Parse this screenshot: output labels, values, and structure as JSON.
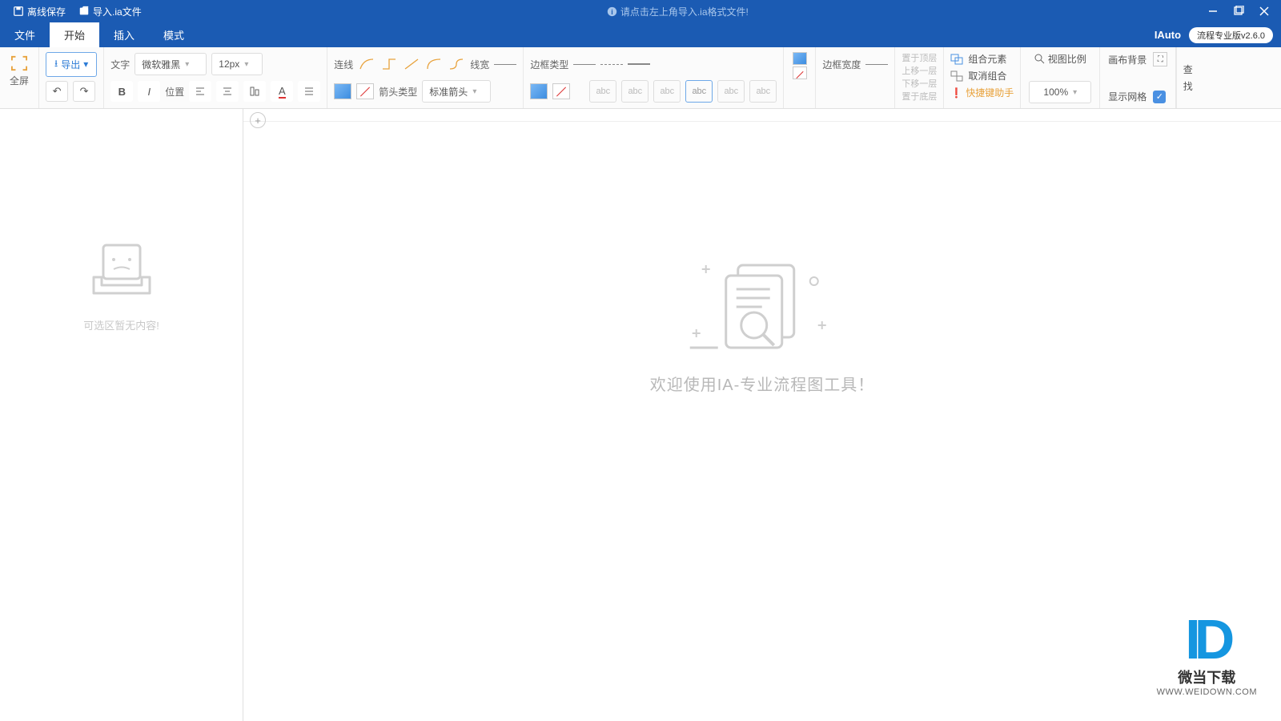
{
  "titlebar": {
    "offline_save": "离线保存",
    "import_ia": "导入.ia文件",
    "hint": "请点击左上角导入.ia格式文件!"
  },
  "menubar": {
    "items": [
      "文件",
      "开始",
      "插入",
      "模式"
    ],
    "active_index": 1,
    "brand": "IAuto",
    "version": "流程专业版v2.6.0"
  },
  "ribbon": {
    "fullscreen": "全屏",
    "export": "导出",
    "text": "文字",
    "font_family": "微软雅黑",
    "font_size": "12px",
    "position": "位置",
    "line": "连线",
    "line_width": "线宽",
    "arrow_type": "箭头类型",
    "arrow_style": "标准箭头",
    "border_type": "边框类型",
    "border_width": "边框宽度",
    "abc": "abc",
    "layer": {
      "top": "置于顶层",
      "up": "上移一层",
      "down": "下移一层",
      "bottom": "置于底层"
    },
    "group": "组合元素",
    "ungroup": "取消组合",
    "hotkey": "快捷键助手",
    "zoom_label": "视图比例",
    "zoom_value": "100%",
    "canvas_bg": "画布背景",
    "show_grid": "显示网格",
    "search": "查",
    "search2": "找"
  },
  "sidebar": {
    "empty": "可选区暂无内容!"
  },
  "canvas": {
    "welcome": "欢迎使用IA-专业流程图工具！"
  },
  "watermark": {
    "logo": "ID",
    "cn": "微当下载",
    "url": "WWW.WEIDOWN.COM"
  }
}
